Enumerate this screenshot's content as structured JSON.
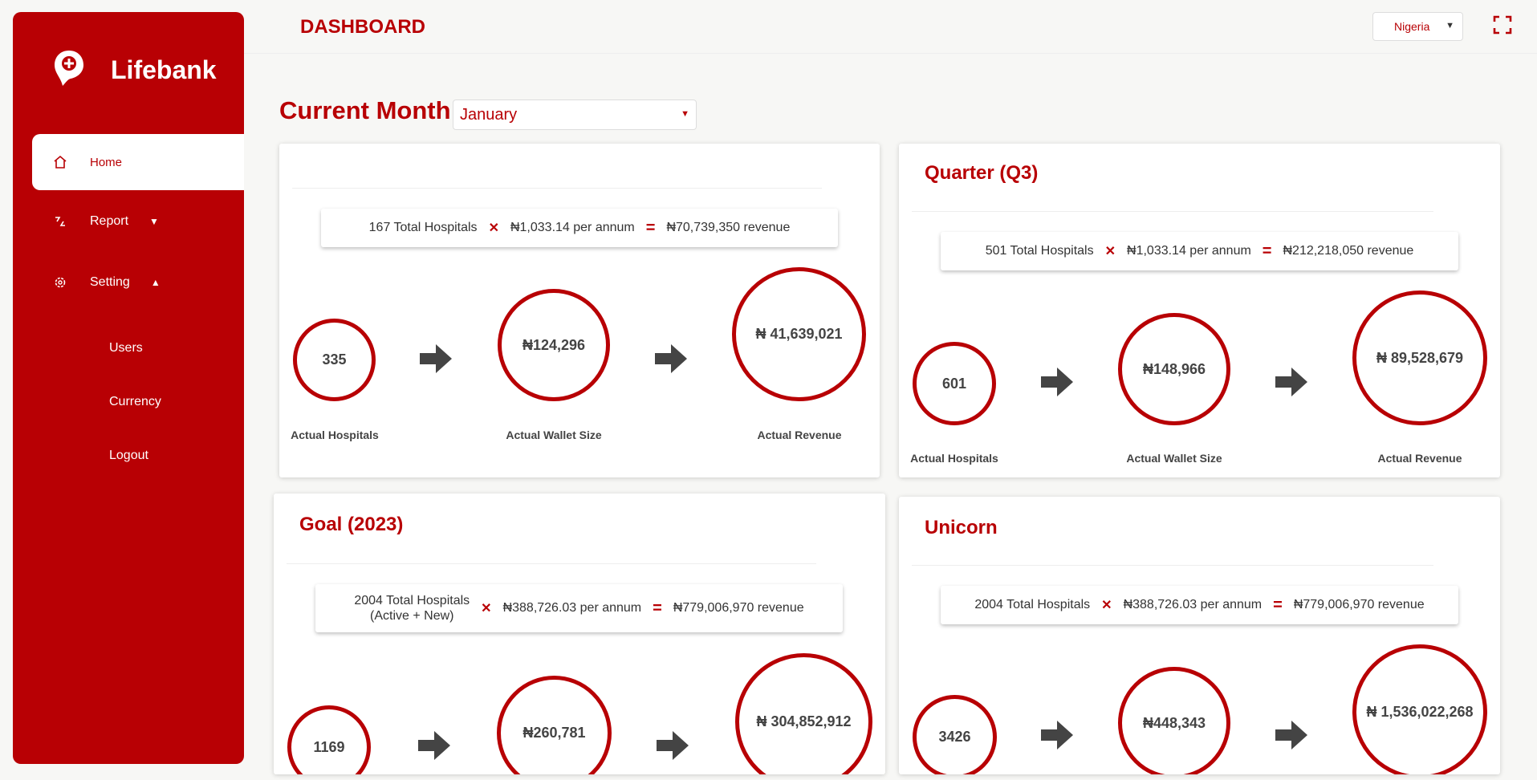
{
  "sidebar": {
    "brand": "Lifebank",
    "items": [
      {
        "label": "Home"
      },
      {
        "label": "Report"
      },
      {
        "label": "Setting"
      }
    ],
    "subitems": [
      {
        "label": "Users"
      },
      {
        "label": "Currency"
      },
      {
        "label": "Logout"
      }
    ]
  },
  "header": {
    "title": "DASHBOARD",
    "country": "Nigeria"
  },
  "month": {
    "label": "Current Month:",
    "value": "January"
  },
  "cards": [
    {
      "title": "",
      "formula": {
        "hospitals": "167 Total Hospitals",
        "rate": "₦1,033.14 per annum",
        "revenue": "₦70,739,350 revenue"
      },
      "circles": [
        "335",
        "₦124,296",
        "₦ 41,639,021"
      ],
      "captions": [
        "Actual Hospitals",
        "Actual Wallet Size",
        "Actual Revenue"
      ]
    },
    {
      "title": "Quarter (Q3)",
      "formula": {
        "hospitals": "501 Total Hospitals",
        "rate": "₦1,033.14 per annum",
        "revenue": "₦212,218,050 revenue"
      },
      "circles": [
        "601",
        "₦148,966",
        "₦ 89,528,679"
      ],
      "captions": [
        "Actual Hospitals",
        "Actual Wallet Size",
        "Actual Revenue"
      ]
    },
    {
      "title": "Goal (2023)",
      "formula": {
        "hospitals_line1": "2004 Total Hospitals",
        "hospitals_line2": "(Active + New)",
        "rate": "₦388,726.03 per annum",
        "revenue": "₦779,006,970 revenue"
      },
      "circles": [
        "1169",
        "₦260,781",
        "₦ 304,852,912"
      ]
    },
    {
      "title": "Unicorn",
      "formula": {
        "hospitals": "2004 Total Hospitals",
        "rate": "₦388,726.03 per annum",
        "revenue": "₦779,006,970 revenue"
      },
      "circles": [
        "3426",
        "₦448,343",
        "₦ 1,536,022,268"
      ]
    }
  ],
  "colors": {
    "accent": "#b80004",
    "background": "#f7f7f5"
  },
  "icons": [
    "brand-logo-icon",
    "home-icon",
    "report-icon",
    "gear-icon",
    "caret-down-icon",
    "caret-up-icon",
    "fullscreen-icon",
    "arrow-right-icon"
  ]
}
